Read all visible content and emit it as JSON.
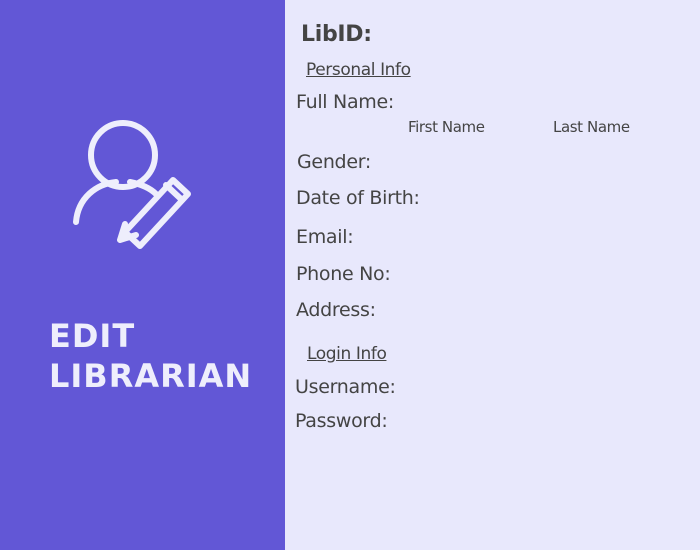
{
  "sidebar": {
    "icon": "user-edit-icon",
    "title_line1": "EDIT",
    "title_line2": "LIBRARIAN"
  },
  "form": {
    "libid_label": "LibID:",
    "personal_section": "Personal Info",
    "full_name_label": "Full Name:",
    "first_name_hint": "First Name",
    "last_name_hint": "Last Name",
    "gender_label": "Gender:",
    "dob_label": "Date of Birth:",
    "email_label": "Email:",
    "phone_label": "Phone No:",
    "address_label": "Address:",
    "login_section": "Login Info",
    "username_label": "Username:",
    "password_label": "Password:"
  },
  "colors": {
    "sidebar_bg": "#6257d6",
    "form_bg": "#e8e8fc",
    "sidebar_text": "#eeeefc",
    "label_text": "#444444"
  }
}
